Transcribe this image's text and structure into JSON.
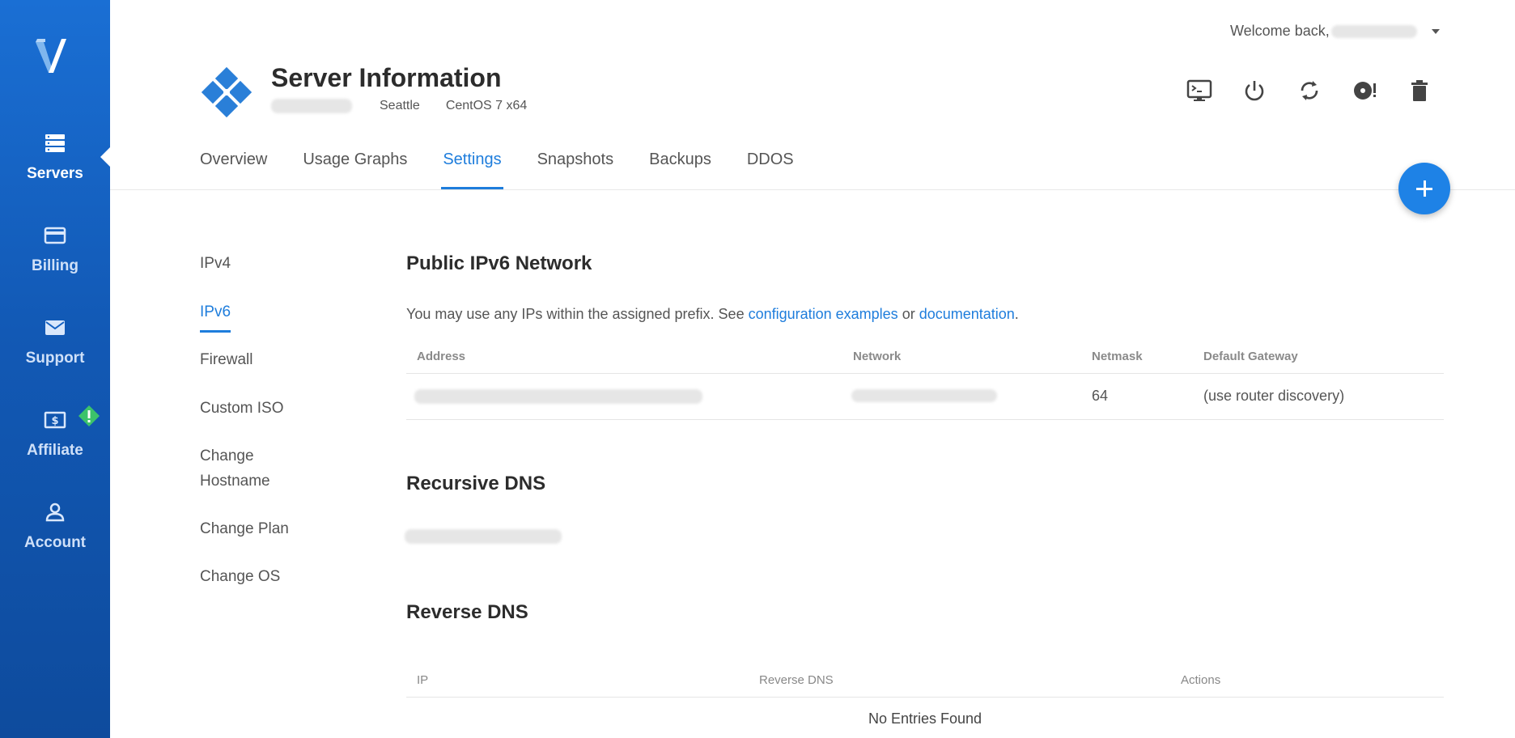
{
  "sidebar": {
    "items": [
      {
        "label": "Servers",
        "icon": "server-stack-icon"
      },
      {
        "label": "Billing",
        "icon": "credit-card-icon"
      },
      {
        "label": "Support",
        "icon": "envelope-icon"
      },
      {
        "label": "Affiliate",
        "icon": "dollar-bill-icon"
      },
      {
        "label": "Account",
        "icon": "user-icon"
      }
    ],
    "active": "Servers",
    "affiliate_badge": "!"
  },
  "header": {
    "welcome": "Welcome back,",
    "title": "Server Information",
    "location": "Seattle",
    "os": "CentOS 7 x64",
    "actions": [
      "console-icon",
      "power-icon",
      "restart-icon",
      "reinstall-icon",
      "trash-icon"
    ]
  },
  "tabs": [
    "Overview",
    "Usage Graphs",
    "Settings",
    "Snapshots",
    "Backups",
    "DDOS"
  ],
  "active_tab": "Settings",
  "subnav": [
    "IPv4",
    "IPv6",
    "Firewall",
    "Custom ISO",
    "Change Hostname",
    "Change Plan",
    "Change OS"
  ],
  "active_subnav": "IPv6",
  "ipv6": {
    "title": "Public IPv6 Network",
    "desc_prefix": "You may use any IPs within the assigned prefix. See ",
    "link1": "configuration examples",
    "desc_mid": " or ",
    "link2": "documentation",
    "desc_suffix": ".",
    "columns": [
      "Address",
      "Network",
      "Netmask",
      "Default Gateway"
    ],
    "row": {
      "netmask": "64",
      "gateway": "(use router discovery)"
    }
  },
  "recursive_dns": {
    "title": "Recursive DNS"
  },
  "reverse_dns": {
    "title": "Reverse DNS",
    "columns": [
      "IP",
      "Reverse DNS",
      "Actions"
    ],
    "empty": "No Entries Found"
  },
  "colors": {
    "accent": "#1e7ddc",
    "sidebar": "#1565c0",
    "fab": "#1e82e6",
    "badge": "#3cc36a"
  }
}
